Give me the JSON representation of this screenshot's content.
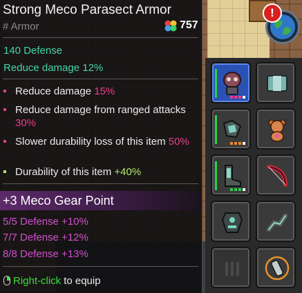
{
  "item": {
    "name": "Strong Meco Parasect Armor",
    "category": "# Armor",
    "price": "757",
    "base_stats": [
      "140 Defense",
      "Reduce damage 12%"
    ],
    "effects": [
      {
        "text": "Reduce damage ",
        "value": "15%",
        "bullet_color": "#ee3d8a",
        "value_color": "#ee3d8a"
      },
      {
        "text": "Reduce damage from ranged attacks ",
        "value": "30%",
        "bullet_color": "#ee3d8a",
        "value_color": "#ee3d8a"
      },
      {
        "text": "Slower durability loss of this item ",
        "value": "50%",
        "bullet_color": "#ee3d8a",
        "value_color": "#ee3d8a"
      },
      {
        "text": "Durability of this item ",
        "value": "+40%",
        "bullet_color": "#b6e86c",
        "value_color": "#b6e86c"
      }
    ],
    "set_bonus": {
      "title": "+3 Meco Gear Point",
      "lines": [
        "5/5 Defense +10%",
        "7/7 Defense +12%",
        "8/8 Defense +13%"
      ]
    },
    "equip_hint": {
      "action": "Right-click",
      "rest": "to equip"
    }
  },
  "colors": {
    "accent_teal": "#46d6a8",
    "accent_pink": "#ee3d8a",
    "accent_green": "#b6e86c",
    "set_purple": "#d14fcf",
    "selected_slot": "#2a52b4"
  },
  "inventory": {
    "slots": [
      {
        "icon": "meco-helmet-icon",
        "selected": true,
        "equipped": true,
        "pips": [
          "#ee3d8a",
          "#ee3d8a",
          "#ee3d8a",
          "#ffffff"
        ]
      },
      {
        "icon": "metal-crate-icon",
        "selected": false,
        "equipped": false,
        "pips": []
      },
      {
        "icon": "meco-gauntlet-icon",
        "selected": false,
        "equipped": true,
        "pips": [
          "#f08a24",
          "#f08a24",
          "#f08a24",
          "#ffffff"
        ]
      },
      {
        "icon": "teddy-bear-icon",
        "selected": false,
        "equipped": false,
        "pips": []
      },
      {
        "icon": "meco-boots-icon",
        "selected": false,
        "equipped": true,
        "pips": [
          "#28d44a",
          "#28d44a",
          "#28d44a",
          "#ffffff"
        ]
      },
      {
        "icon": "red-shell-bow-icon",
        "selected": false,
        "equipped": false,
        "pips": []
      },
      {
        "icon": "meco-armor-icon",
        "selected": false,
        "equipped": false,
        "pips": []
      },
      {
        "icon": "mechanical-arm-icon",
        "selected": false,
        "equipped": false,
        "pips": []
      },
      {
        "icon": "empty-slot-icon",
        "selected": false,
        "equipped": false,
        "pips": []
      },
      {
        "icon": "bandage-potion-icon",
        "selected": false,
        "equipped": false,
        "pips": []
      }
    ]
  },
  "hud": {
    "alert_icon": "exclamation-icon",
    "map_icon": "globe-icon",
    "alert_symbol": "!"
  }
}
